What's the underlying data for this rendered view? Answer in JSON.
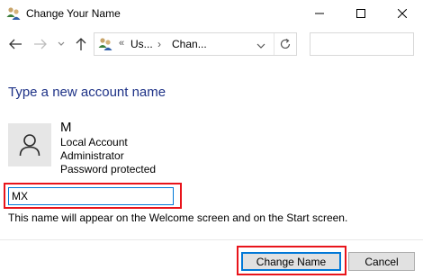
{
  "window": {
    "title": "Change Your Name",
    "controls": {
      "minimize": "minimize",
      "maximize": "maximize",
      "close": "close"
    }
  },
  "nav": {
    "breadcrumb": {
      "overflow": "«",
      "segments": [
        "Us...",
        "Chan..."
      ],
      "separator": "›"
    },
    "search": {
      "value": ""
    }
  },
  "content": {
    "heading": "Type a new account name",
    "account": {
      "name": "M",
      "details": [
        "Local Account",
        "Administrator",
        "Password protected"
      ]
    },
    "name_input": {
      "value": "MX"
    },
    "helper_text": "This name will appear on the Welcome screen and on the Start screen."
  },
  "buttons": {
    "change_name": "Change Name",
    "cancel": "Cancel"
  },
  "colors": {
    "heading": "#1e3287",
    "highlight": "#e8141b",
    "focus": "#0078d7",
    "button_face": "#e1e1e1"
  },
  "icons": {
    "app": "users-icon",
    "back": "arrow-left-icon",
    "forward": "arrow-right-icon",
    "recent": "chevron-down-icon",
    "up": "arrow-up-icon",
    "refresh": "refresh-icon",
    "avatar": "user-icon"
  }
}
